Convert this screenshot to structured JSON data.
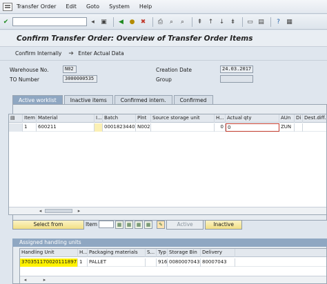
{
  "menu": [
    "Transfer Order",
    "Edit",
    "Goto",
    "System",
    "Help"
  ],
  "toolbar_icons": [
    "enter-icon",
    "command-field",
    "save-icon",
    "back-icon",
    "exit-icon",
    "cancel-icon",
    "print-icon",
    "find-icon",
    "find-next-icon",
    "first-page-icon",
    "prev-page-icon",
    "next-page-icon",
    "last-page-icon",
    "new-session-icon",
    "shortcut-icon",
    "help-icon",
    "customize-icon"
  ],
  "title": "Confirm Transfer Order: Overview of Transfer Order Items",
  "appbar": {
    "confirm_internally": "Confirm Internally",
    "enter_actual_data": "Enter Actual Data"
  },
  "header": {
    "warehouse_label": "Warehouse No.",
    "warehouse_value": "N02",
    "to_label": "TO Number",
    "to_value": "3000000535",
    "creation_label": "Creation Date",
    "creation_value": "24.03.2017",
    "group_label": "Group",
    "group_value": ""
  },
  "tabs": [
    "Active worklist",
    "Inactive items",
    "Confirmed intern.",
    "Confirmed"
  ],
  "items_table": {
    "columns": [
      "Item",
      "Material",
      "I...",
      "Batch",
      "Plnt",
      "Source storage unit",
      "H...",
      "Actual qty",
      "AUn",
      "Di",
      "Dest.diff.q"
    ],
    "rows": [
      {
        "item": "1",
        "material": "600211",
        "i": "",
        "batch": "0001823440",
        "plnt": "N002",
        "source_su": "",
        "h": "0",
        "actual_qty": "0",
        "aun": "ZUN",
        "di": "",
        "dest_diff": ""
      }
    ]
  },
  "buttons": {
    "select_from": "Select from",
    "item_label": "Item",
    "item_value": "",
    "active": "Active",
    "inactive": "Inactive"
  },
  "assigned": {
    "title": "Assigned handling units",
    "columns": [
      "Handling Unit",
      "H...",
      "Packaging materials",
      "S...",
      "Typ",
      "Storage Bin",
      "Delivery"
    ],
    "rows": [
      {
        "hu": "370351170020111897",
        "h": "1",
        "pack": "PALLET",
        "s": "",
        "typ": "916",
        "bin": "0080007043",
        "delivery": "80007043"
      }
    ]
  },
  "colors": {
    "tab_active": "#8fa7c2",
    "highlight": "#fff200",
    "background": "#dfe6ee"
  }
}
